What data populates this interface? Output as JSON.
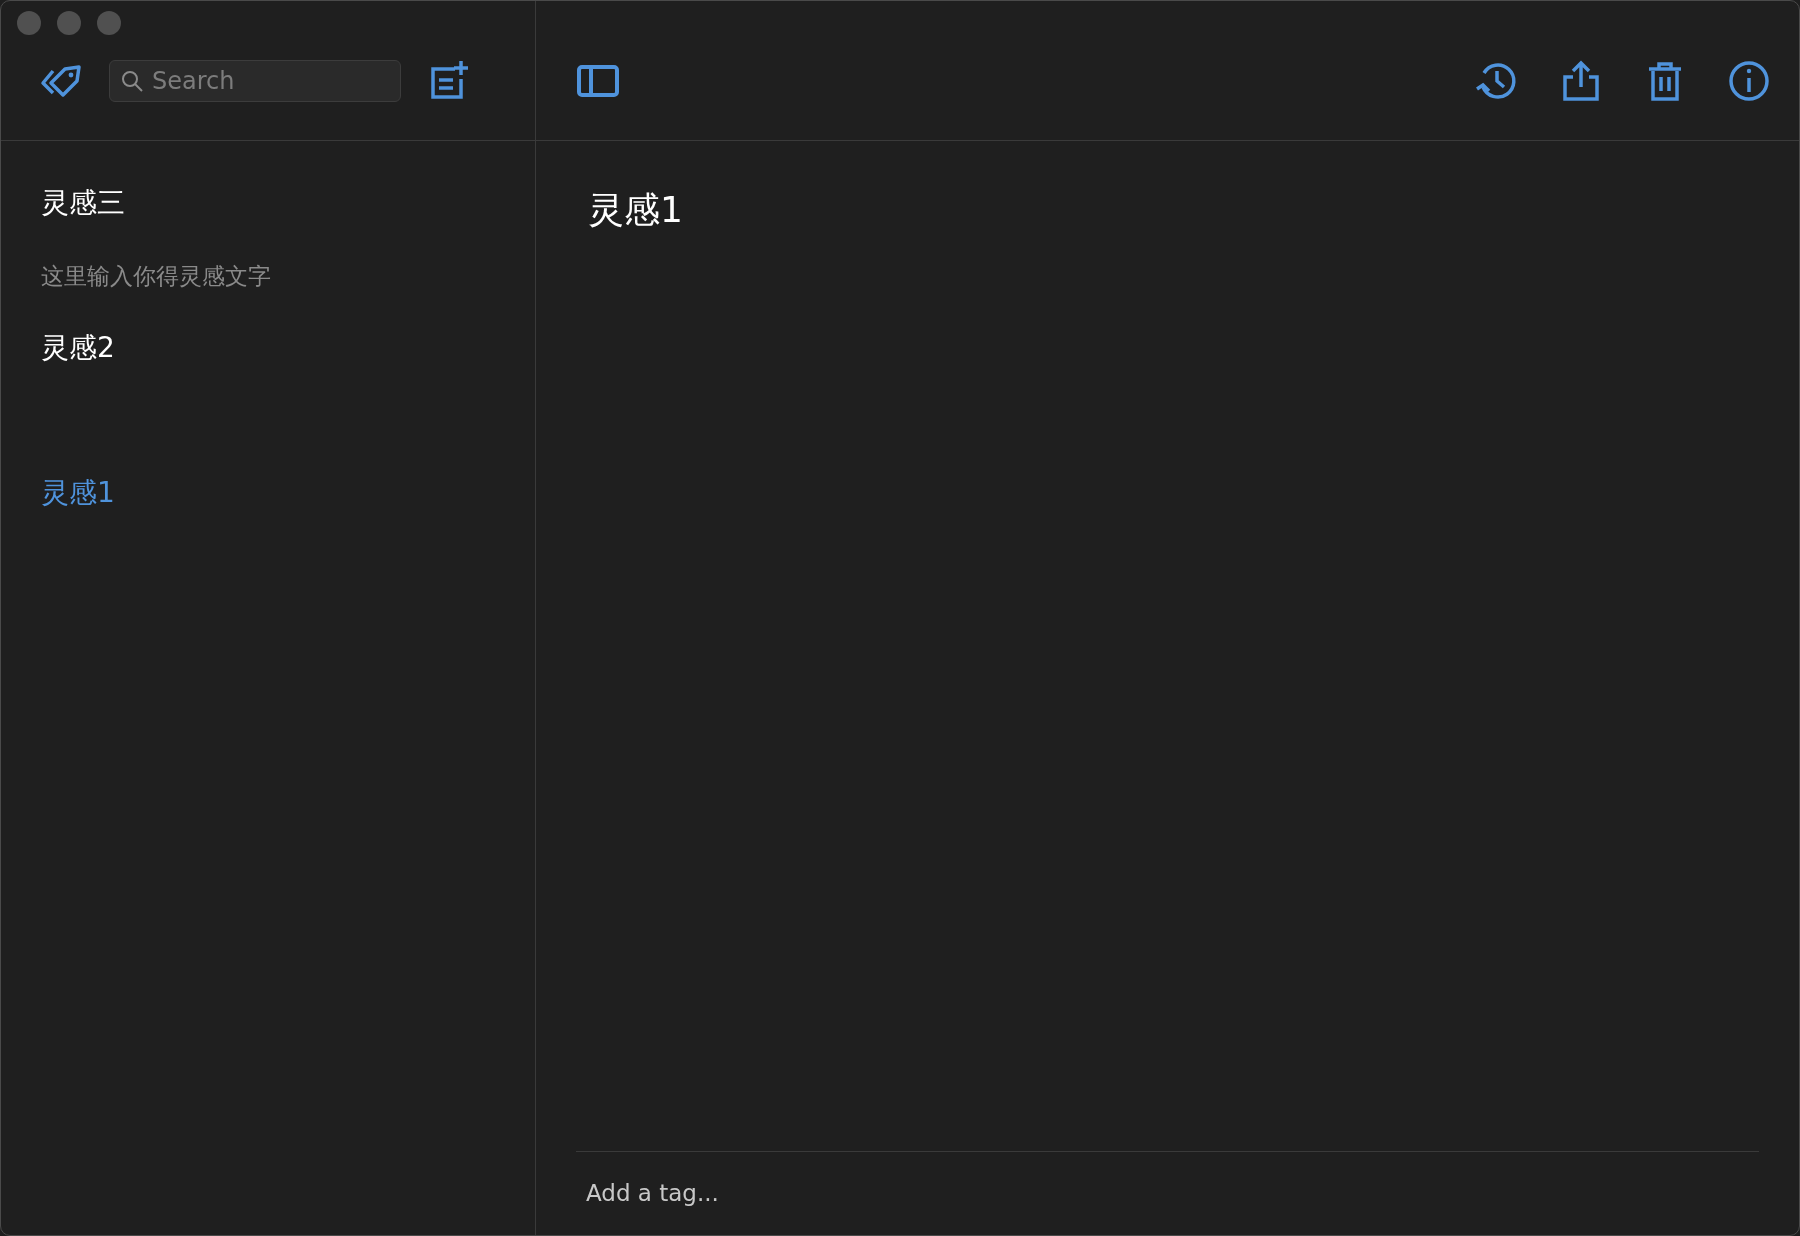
{
  "search": {
    "placeholder": "Search"
  },
  "notes": [
    {
      "title": "灵感三",
      "preview": "这里输入你得灵感文字",
      "selected": false
    },
    {
      "title": "灵感2",
      "selected": false
    },
    {
      "title": "灵感1",
      "selected": true
    }
  ],
  "editor": {
    "title": "灵感1"
  },
  "tag_field": {
    "placeholder": "Add a tag..."
  }
}
